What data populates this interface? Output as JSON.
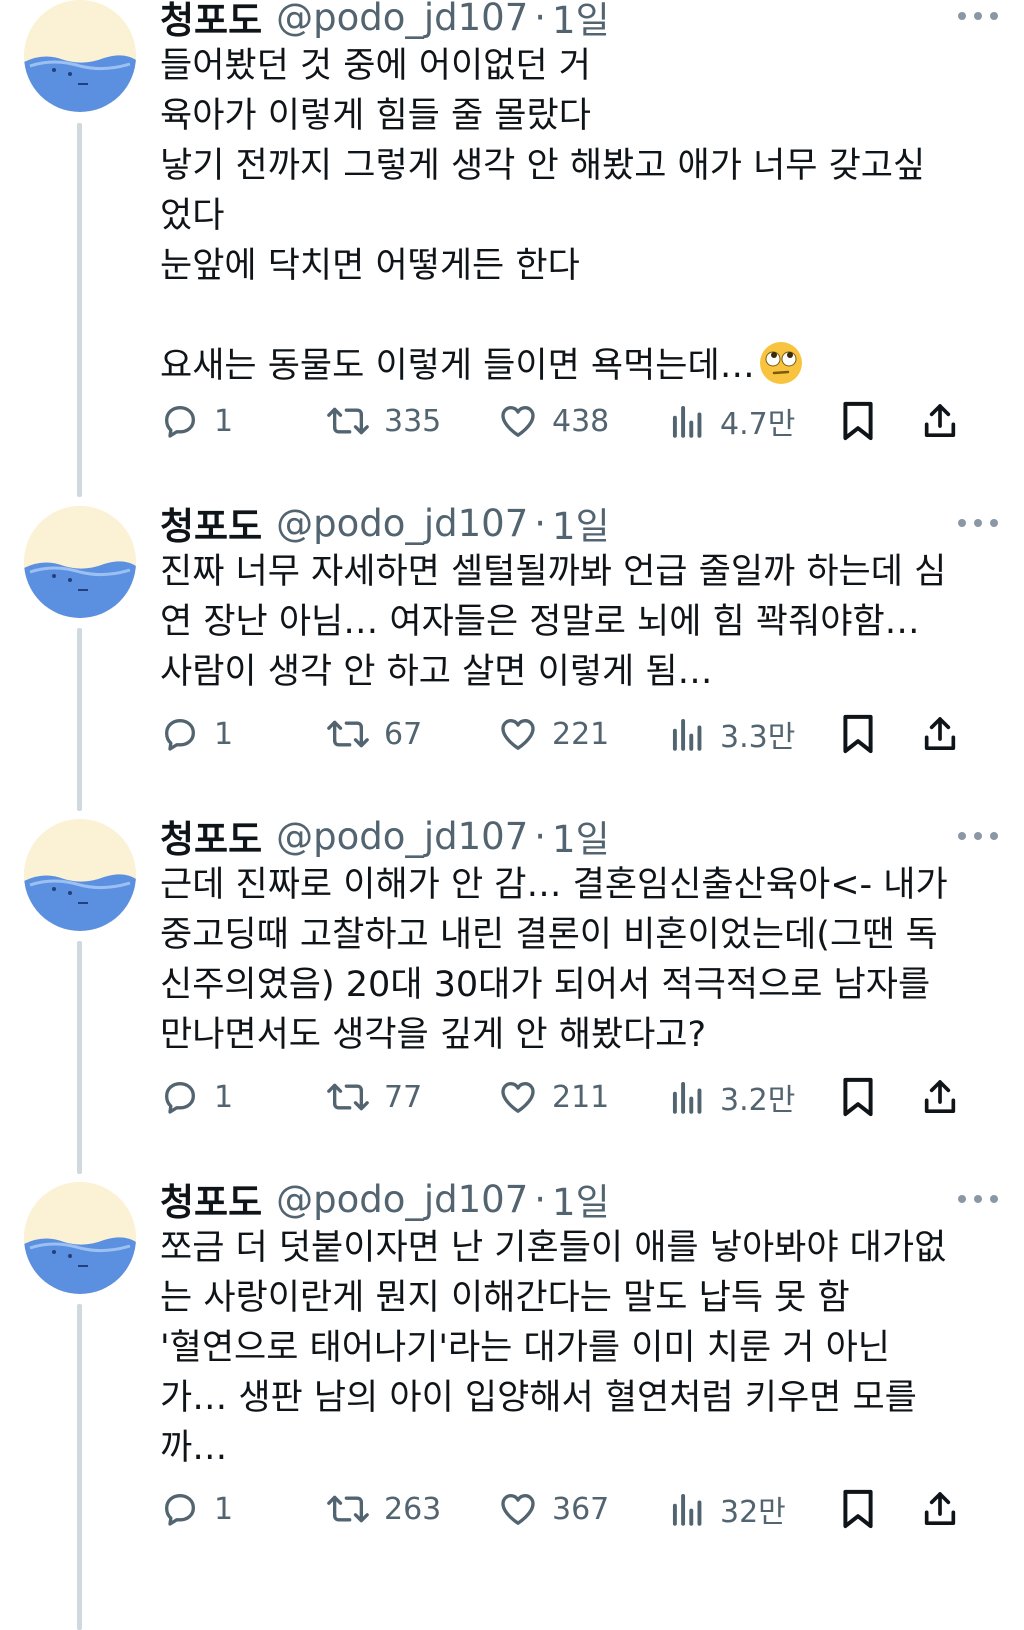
{
  "tweets": [
    {
      "author": {
        "name": "청포도",
        "handle": "@podo_jd107",
        "separator": "·",
        "time": "1일"
      },
      "lines": [
        "들어봤던 것 중에 어이없던 거",
        "육아가 이렇게 힘들 줄 몰랐다",
        "낳기 전까지 그렇게 생각 안 해봤고 애가 너무 갖고싶",
        "었다",
        "눈앞에 닥치면 어떻게든 한다",
        "",
        "요새는 동물도 이렇게 들이면 욕먹는데…"
      ],
      "emoji": "face-with-rolling-eyes-emoji",
      "stats": {
        "replies": "1",
        "retweets": "335",
        "likes": "438",
        "views": "4.7만"
      }
    },
    {
      "author": {
        "name": "청포도",
        "handle": "@podo_jd107",
        "separator": "·",
        "time": "1일"
      },
      "lines": [
        "진짜 너무 자세하면 셀털될까봐 언급 줄일까 하는데 심",
        "연 장난 아님… 여자들은 정말로 뇌에 힘 꽉줘야함…",
        "사람이 생각 안 하고 살면 이렇게 됨…"
      ],
      "stats": {
        "replies": "1",
        "retweets": "67",
        "likes": "221",
        "views": "3.3만"
      }
    },
    {
      "author": {
        "name": "청포도",
        "handle": "@podo_jd107",
        "separator": "·",
        "time": "1일"
      },
      "lines": [
        "근데 진짜로 이해가 안 감… 결혼임신출산육아<- 내가",
        "중고딩때 고찰하고 내린 결론이 비혼이었는데(그땐 독",
        "신주의였음) 20대 30대가 되어서 적극적으로 남자를",
        "만나면서도 생각을 깊게 안 해봤다고?"
      ],
      "stats": {
        "replies": "1",
        "retweets": "77",
        "likes": "211",
        "views": "3.2만"
      }
    },
    {
      "author": {
        "name": "청포도",
        "handle": "@podo_jd107",
        "separator": "·",
        "time": "1일"
      },
      "lines": [
        "쪼금 더 덧붙이자면 난 기혼들이 애를 낳아봐야 대가없",
        "는 사랑이란게 뭔지 이해간다는 말도 납득 못 함",
        "'혈연으로 태어나기'라는 대가를 이미 치룬 거 아닌",
        "가… 생판 남의 아이 입양해서 혈연처럼 키우면 모를",
        "까…"
      ],
      "stats": {
        "replies": "1",
        "retweets": "263",
        "likes": "367",
        "views": "32만"
      }
    }
  ],
  "icons": {
    "reply": "reply-icon",
    "retweet": "retweet-icon",
    "like": "heart-icon",
    "views": "views-chart-icon",
    "bookmark": "bookmark-icon",
    "share": "share-icon",
    "more": "more-dots-icon"
  },
  "colors": {
    "text": "#0f1419",
    "secondary": "#536471",
    "thread_line": "#cfd9de",
    "avatar_blue": "#5b8fe0"
  }
}
